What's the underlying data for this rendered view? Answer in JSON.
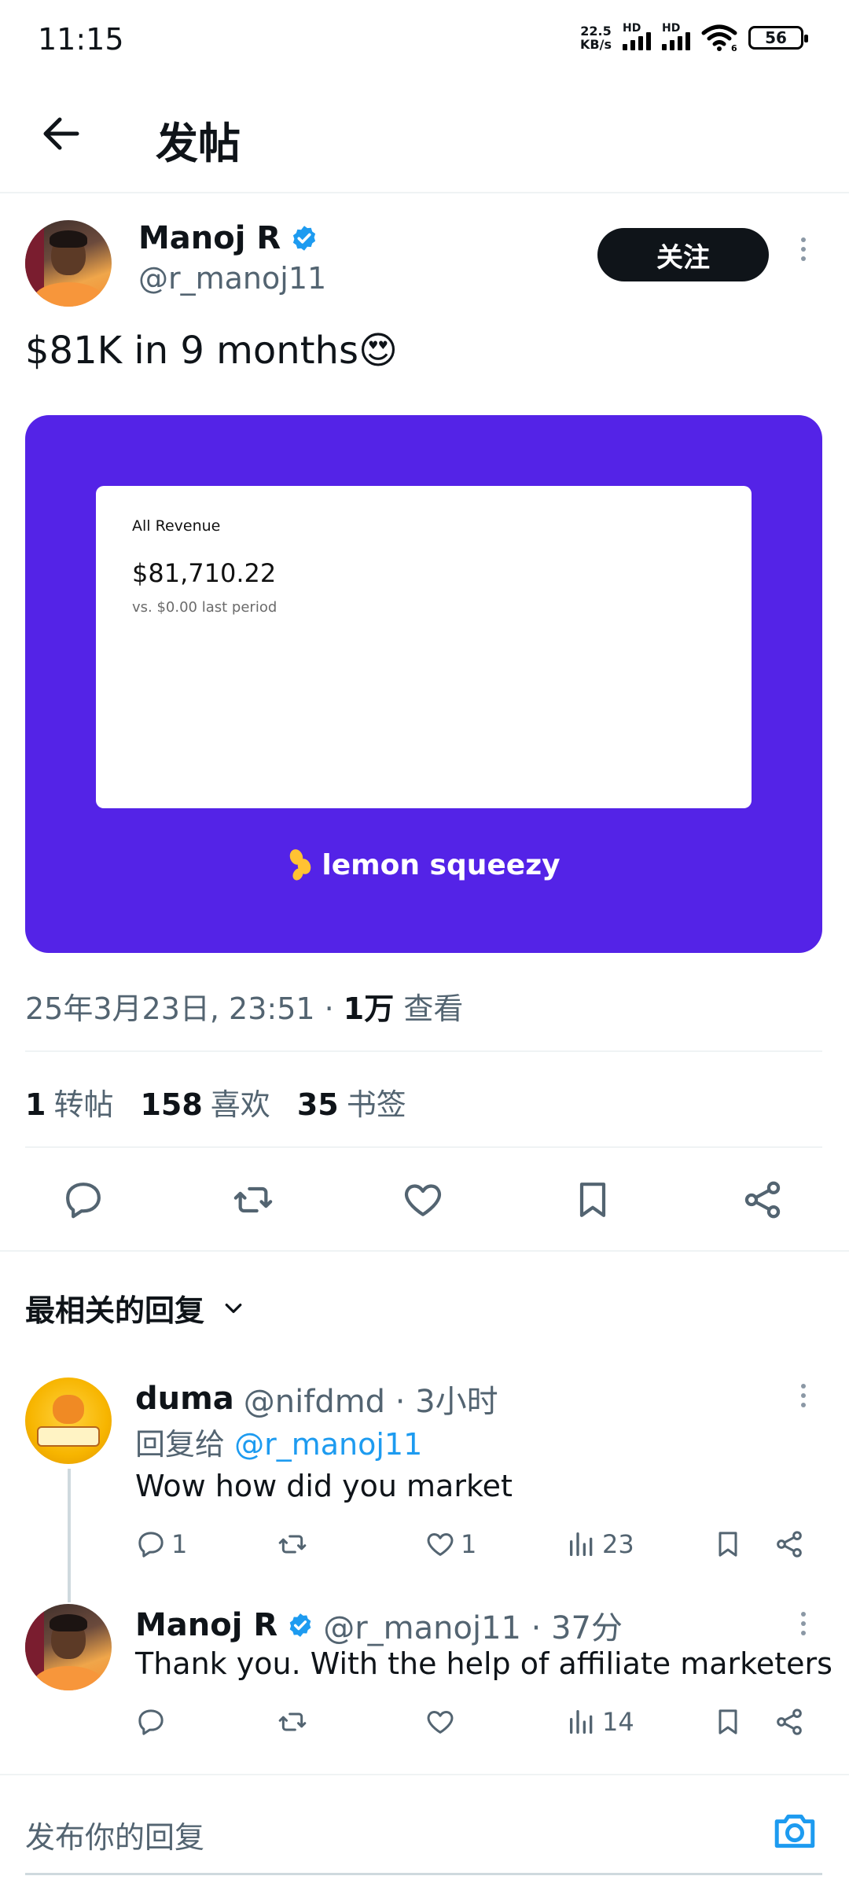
{
  "status_bar": {
    "time": "11:15",
    "net_speed_top": "22.5",
    "net_speed_bottom": "KB/s",
    "sim1_label": "HD",
    "sim2_label": "HD",
    "wifi_badge": "6",
    "battery": "56"
  },
  "header": {
    "title": "发帖"
  },
  "post": {
    "author_name": "Manoj R",
    "author_handle": "@r_manoj11",
    "follow_label": "关注",
    "text": "$81K in 9 months😍",
    "media": {
      "revenue_label": "All Revenue",
      "revenue_value": "$81,710.22",
      "revenue_compare": "vs. $0.00 last period",
      "brand": "lemon squeezy",
      "background_color": "#5423e7"
    },
    "timestamp": "25年3月23日, 23:51 · ",
    "views_count": "1万",
    "views_label": " 查看",
    "stats": {
      "reposts_count": "1",
      "reposts_label": "转帖",
      "likes_count": "158",
      "likes_label": "喜欢",
      "bookmarks_count": "35",
      "bookmarks_label": "书签"
    }
  },
  "replies_sort": {
    "label": "最相关的回复"
  },
  "replies": [
    {
      "name": "duma",
      "handle": "@nifdmd · 3小时",
      "reply_to_prefix": "回复给 ",
      "reply_to_handle": "@r_manoj11",
      "text": "Wow how did you market",
      "reply_count": "1",
      "repost_count": "",
      "like_count": "1",
      "views_count": "23"
    },
    {
      "name": "Manoj R",
      "handle": "@r_manoj11 · 37分",
      "text": "Thank you. With the help of affiliate marketers",
      "reply_count": "",
      "repost_count": "",
      "like_count": "",
      "views_count": "14"
    }
  ],
  "compose": {
    "placeholder": "发布你的回复"
  },
  "colors": {
    "accent": "#1d9bf0",
    "text_primary": "#0f1419",
    "text_secondary": "#536471",
    "brand_lemon": "#ffc233"
  }
}
